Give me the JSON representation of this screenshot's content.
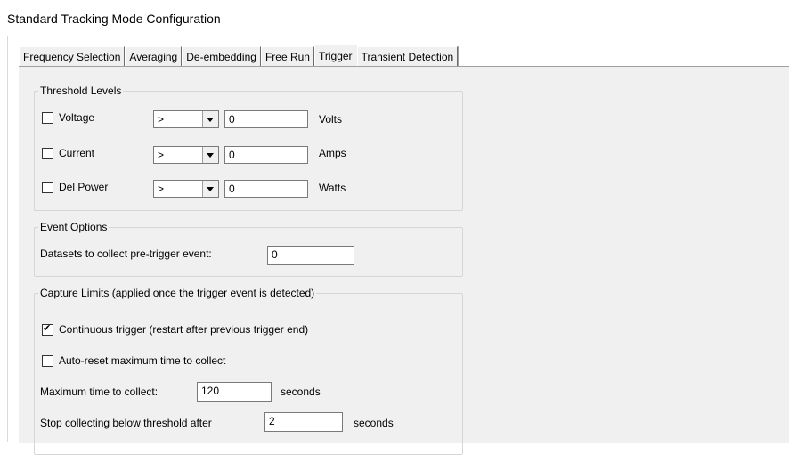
{
  "window": {
    "title": "Standard Tracking Mode Configuration"
  },
  "tabs": [
    {
      "label": "Frequency Selection"
    },
    {
      "label": "Averaging"
    },
    {
      "label": "De-embedding"
    },
    {
      "label": "Free Run"
    },
    {
      "label": "Trigger"
    },
    {
      "label": "Transient Detection"
    }
  ],
  "active_tab": "Trigger",
  "threshold_levels": {
    "title": "Threshold Levels",
    "rows": [
      {
        "label": "Voltage",
        "checked": false,
        "operator": ">",
        "value": "0",
        "unit": "Volts"
      },
      {
        "label": "Current",
        "checked": false,
        "operator": ">",
        "value": "0",
        "unit": "Amps"
      },
      {
        "label": "Del Power",
        "checked": false,
        "operator": ">",
        "value": "0",
        "unit": "Watts"
      }
    ]
  },
  "event_options": {
    "title": "Event Options",
    "pretrigger_label": "Datasets to collect pre-trigger event:",
    "pretrigger_value": "0"
  },
  "capture_limits": {
    "title": "Capture Limits (applied once the trigger event is detected)",
    "continuous_label": "Continuous trigger (restart after previous trigger end)",
    "continuous_checked": true,
    "autoreset_label": "Auto-reset maximum time to collect",
    "autoreset_checked": false,
    "max_time_label": "Maximum time to collect:",
    "max_time_value": "120",
    "max_time_unit": "seconds",
    "stop_label": "Stop collecting below threshold after",
    "stop_value": "2",
    "stop_unit": "seconds"
  }
}
